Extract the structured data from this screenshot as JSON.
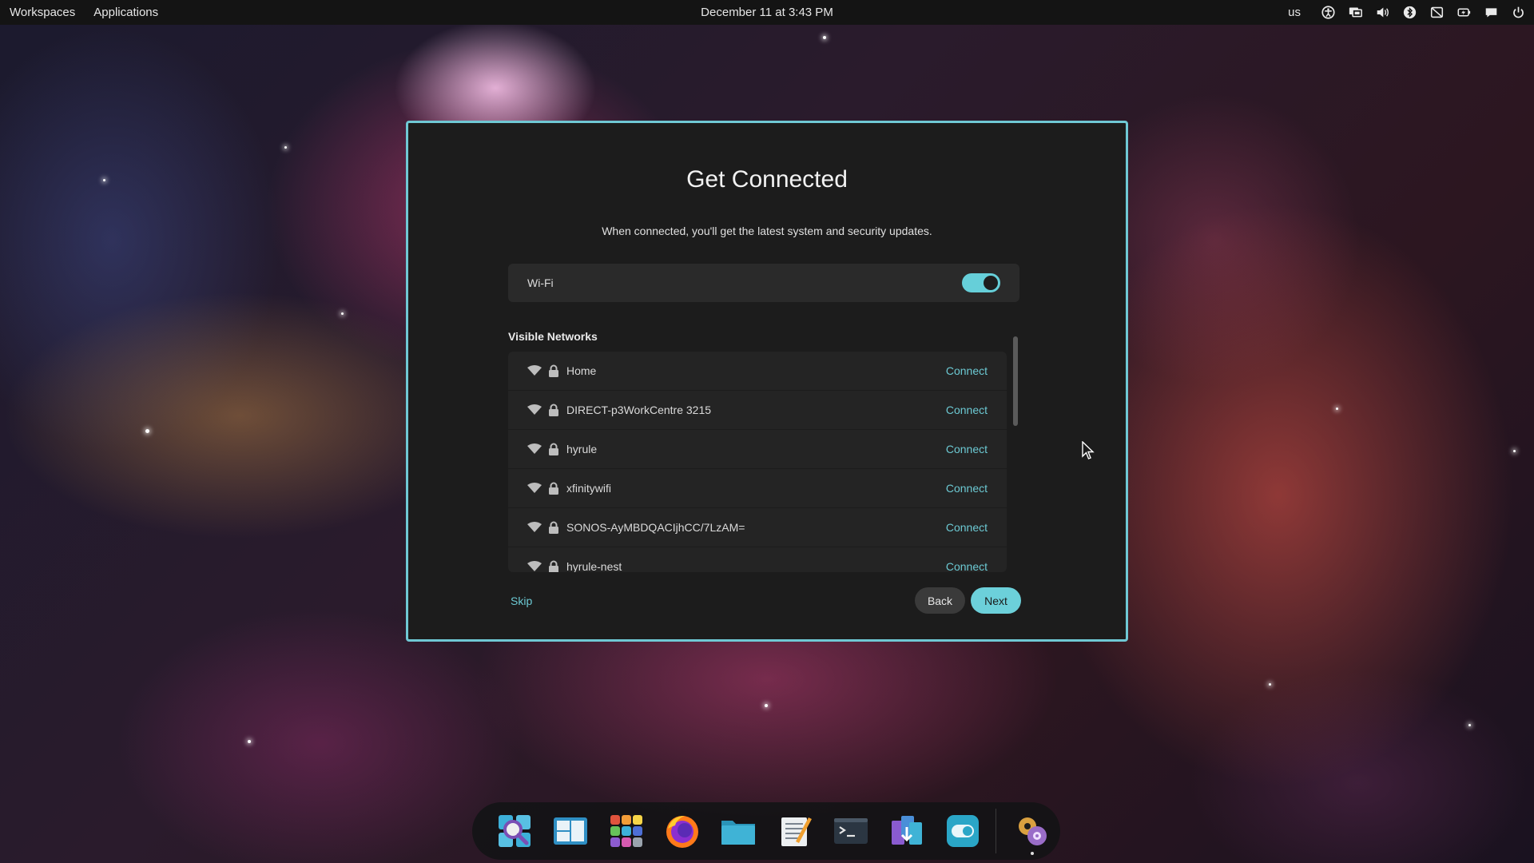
{
  "topbar": {
    "workspaces_label": "Workspaces",
    "applications_label": "Applications",
    "clock": "December 11 at 3:43 PM",
    "keyboard_layout": "us",
    "tray_icons": [
      "accessibility-icon",
      "display-icon",
      "volume-icon",
      "bluetooth-icon",
      "network-off-icon",
      "battery-icon",
      "notifications-icon",
      "power-icon"
    ]
  },
  "dialog": {
    "title": "Get Connected",
    "subtitle": "When connected, you'll get the latest system and security updates.",
    "wifi_label": "Wi-Fi",
    "wifi_enabled": true,
    "networks_heading": "Visible Networks",
    "networks": [
      {
        "ssid": "Home",
        "action": "Connect"
      },
      {
        "ssid": "DIRECT-p3WorkCentre 3215",
        "action": "Connect"
      },
      {
        "ssid": "hyrule",
        "action": "Connect"
      },
      {
        "ssid": "xfinitywifi",
        "action": "Connect"
      },
      {
        "ssid": "SONOS-AyMBDQACIjhCC/7LzAM=",
        "action": "Connect"
      },
      {
        "ssid": "hyrule-nest",
        "action": "Connect"
      }
    ],
    "skip_label": "Skip",
    "back_label": "Back",
    "next_label": "Next"
  },
  "dock": {
    "items": [
      "search-launcher-icon",
      "workspaces-icon",
      "app-grid-icon",
      "firefox-icon",
      "files-icon",
      "text-editor-icon",
      "terminal-icon",
      "installer-icon",
      "settings-toggle-icon",
      "initial-setup-icon"
    ]
  },
  "colors": {
    "accent": "#6cd0da",
    "dialog_border": "#6fc8d4",
    "dialog_bg": "#1c1c1c",
    "topbar_bg": "#141414"
  }
}
